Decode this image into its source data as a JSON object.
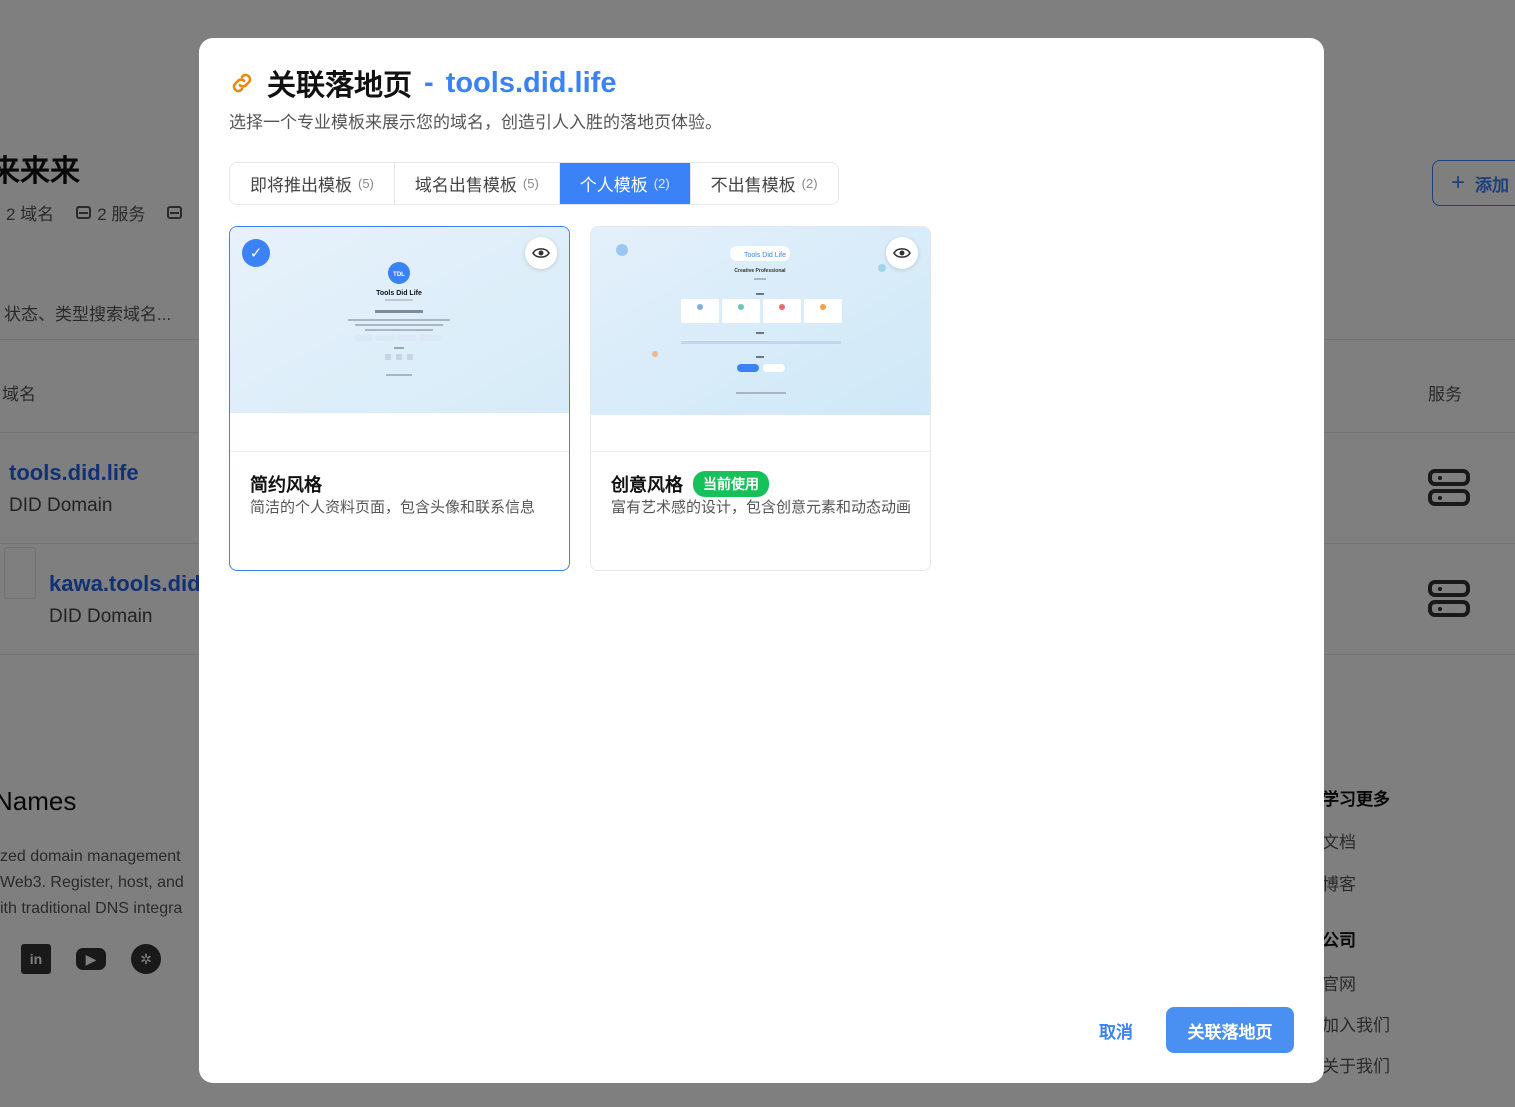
{
  "background": {
    "page_title": "来来来",
    "stats": {
      "domains": "2 域名",
      "services": "2 服务"
    },
    "add_button": "添加",
    "search_placeholder": "状态、类型搜索域名...",
    "columns": {
      "domain": "域名",
      "service": "服务"
    },
    "rows": [
      {
        "name": "tools.did.life",
        "type": "DID Domain"
      },
      {
        "name": "kawa.tools.did.",
        "type": "DID Domain"
      }
    ],
    "footer": {
      "brand": "Names",
      "desc_lines": [
        "zed domain management",
        "Web3. Register, host, and",
        "ith traditional DNS integra"
      ],
      "learn_more": "学习更多",
      "docs": "文档",
      "blog": "博客",
      "company": "公司",
      "website": "官网",
      "join": "加入我们",
      "about": "关于我们"
    }
  },
  "modal": {
    "title": "关联落地页",
    "separator": "-",
    "domain": "tools.did.life",
    "subtitle": "选择一个专业模板来展示您的域名，创造引人入胜的落地页体验。",
    "tabs": [
      {
        "label": "即将推出模板",
        "count": "(5)"
      },
      {
        "label": "域名出售模板",
        "count": "(5)"
      },
      {
        "label": "个人模板",
        "count": "(2)"
      },
      {
        "label": "不出售模板",
        "count": "(2)"
      }
    ],
    "active_tab": 2,
    "templates": [
      {
        "name": "简约风格",
        "desc": "简洁的个人资料页面，包含头像和联系信息",
        "selected": true,
        "preview": {
          "logo": "TDL",
          "title": "Tools Did Life"
        }
      },
      {
        "name": "创意风格",
        "badge": "当前使用",
        "desc": "富有艺术感的设计，包含创意元素和动态动画",
        "selected": false,
        "preview": {
          "title": "Tools Did Life",
          "subtitle": "Creative Professional"
        }
      }
    ],
    "cancel": "取消",
    "confirm": "关联落地页"
  },
  "colors": {
    "accent": "#3b82f6",
    "badge_green": "#16c15a"
  },
  "icons": {
    "title": "link-icon",
    "selected": "check-icon",
    "preview": "eye-icon"
  }
}
